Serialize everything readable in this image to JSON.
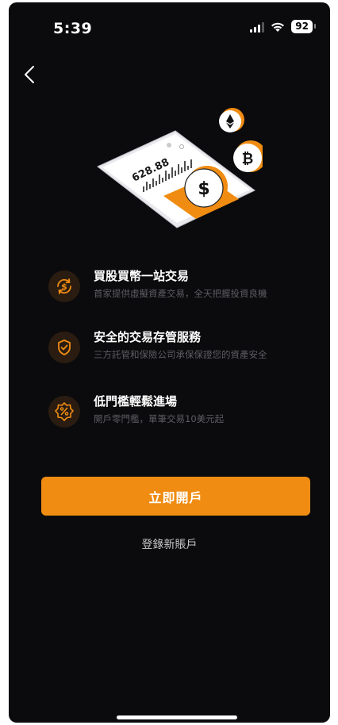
{
  "status_bar": {
    "time": "5:39",
    "battery": "92"
  },
  "features": [
    {
      "icon": "coin-exchange-icon",
      "title": "買股買幣一站交易",
      "desc": "首家提供虛擬資產交易，全天把握投資良機"
    },
    {
      "icon": "shield-check-icon",
      "title": "安全的交易存管服務",
      "desc": "三方託管和保險公司承保保證您的資產安全"
    },
    {
      "icon": "percent-badge-icon",
      "title": "低門檻輕鬆進場",
      "desc": "開戶零門檻，單筆交易10美元起"
    }
  ],
  "illustration": {
    "phone_value": "628.88"
  },
  "actions": {
    "open_account": "立即開戶",
    "login": "登錄新賬戶"
  },
  "colors": {
    "accent": "#f08c12",
    "background": "#0b0b0d",
    "desc_text": "#5d5d63"
  }
}
